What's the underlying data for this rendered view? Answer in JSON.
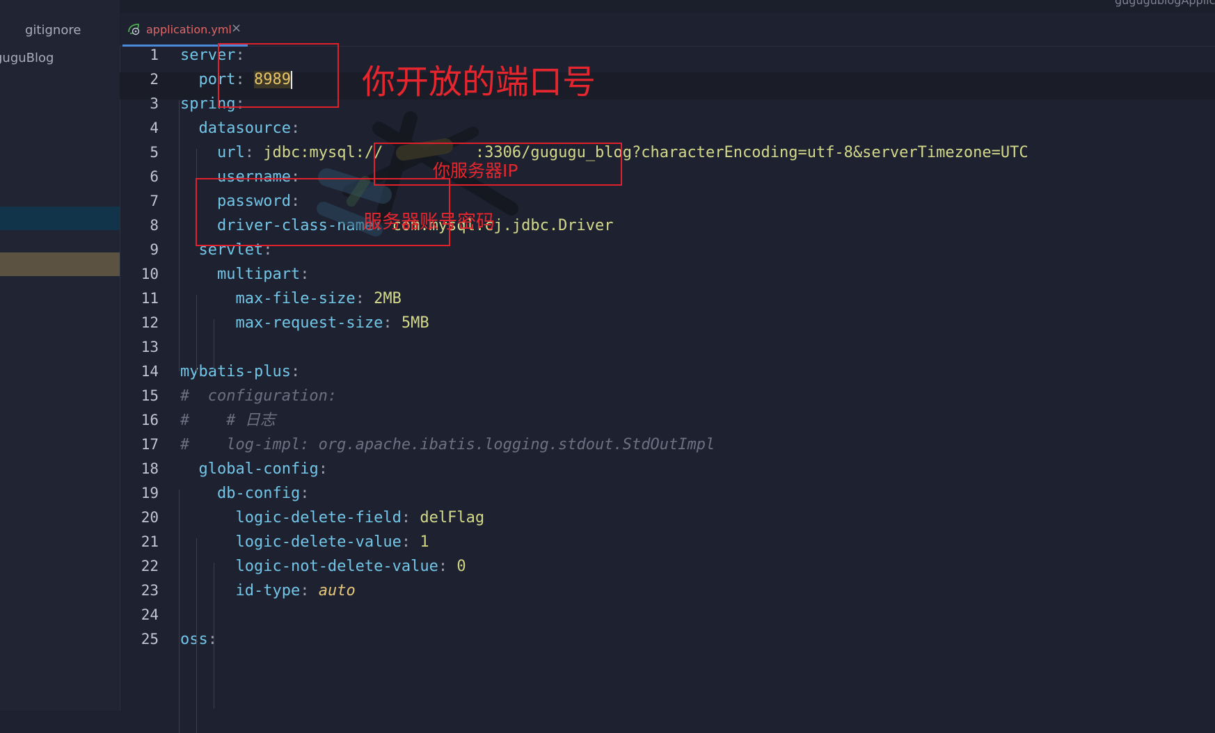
{
  "sidebar": {
    "items": [
      "gitignore",
      "guguBlog"
    ]
  },
  "top": {
    "run_config": "gugugublogApplication"
  },
  "tab": {
    "label": "application.yml",
    "close": "×"
  },
  "editor": {
    "lines": [
      {
        "n": "1",
        "parts": [
          [
            "k",
            "server"
          ],
          [
            "p",
            ":"
          ]
        ]
      },
      {
        "n": "2",
        "parts": [
          [
            "s",
            "  "
          ],
          [
            "k",
            "port"
          ],
          [
            "p",
            ": "
          ],
          [
            "hl",
            "8989"
          ]
        ]
      },
      {
        "n": "3",
        "parts": [
          [
            "k",
            "spring"
          ],
          [
            "p",
            ":"
          ]
        ]
      },
      {
        "n": "4",
        "parts": [
          [
            "s",
            "  "
          ],
          [
            "k",
            "datasource"
          ],
          [
            "p",
            ":"
          ]
        ]
      },
      {
        "n": "5",
        "parts": [
          [
            "s",
            "    "
          ],
          [
            "k",
            "url"
          ],
          [
            "p",
            ": "
          ],
          [
            "v",
            "jdbc:mysql://"
          ],
          [
            "s",
            "          "
          ],
          [
            "v",
            ":3306/gugugu_blog?characterEncoding=utf-8&serverTimezone=UTC"
          ]
        ]
      },
      {
        "n": "6",
        "parts": [
          [
            "s",
            "    "
          ],
          [
            "k",
            "username"
          ],
          [
            "p",
            ":"
          ]
        ]
      },
      {
        "n": "7",
        "parts": [
          [
            "s",
            "    "
          ],
          [
            "k",
            "password"
          ],
          [
            "p",
            ":"
          ]
        ]
      },
      {
        "n": "8",
        "parts": [
          [
            "s",
            "    "
          ],
          [
            "k",
            "driver-class-name"
          ],
          [
            "p",
            ": "
          ],
          [
            "v",
            "com.mysql.cj.jdbc.Driver"
          ]
        ]
      },
      {
        "n": "9",
        "parts": [
          [
            "s",
            "  "
          ],
          [
            "k",
            "servlet"
          ],
          [
            "p",
            ":"
          ]
        ]
      },
      {
        "n": "10",
        "parts": [
          [
            "s",
            "    "
          ],
          [
            "k",
            "multipart"
          ],
          [
            "p",
            ":"
          ]
        ]
      },
      {
        "n": "11",
        "parts": [
          [
            "s",
            "      "
          ],
          [
            "k",
            "max-file-size"
          ],
          [
            "p",
            ": "
          ],
          [
            "v",
            "2MB"
          ]
        ]
      },
      {
        "n": "12",
        "parts": [
          [
            "s",
            "      "
          ],
          [
            "k",
            "max-request-size"
          ],
          [
            "p",
            ": "
          ],
          [
            "v",
            "5MB"
          ]
        ]
      },
      {
        "n": "13",
        "parts": []
      },
      {
        "n": "14",
        "parts": [
          [
            "k",
            "mybatis-plus"
          ],
          [
            "p",
            ":"
          ]
        ]
      },
      {
        "n": "15",
        "parts": [
          [
            "c",
            "#  configuration:"
          ]
        ]
      },
      {
        "n": "16",
        "parts": [
          [
            "c",
            "#    # 日志"
          ]
        ]
      },
      {
        "n": "17",
        "parts": [
          [
            "c",
            "#    log-impl: org.apache.ibatis.logging.stdout.StdOutImpl"
          ]
        ]
      },
      {
        "n": "18",
        "parts": [
          [
            "s",
            "  "
          ],
          [
            "k",
            "global-config"
          ],
          [
            "p",
            ":"
          ]
        ]
      },
      {
        "n": "19",
        "parts": [
          [
            "s",
            "    "
          ],
          [
            "k",
            "db-config"
          ],
          [
            "p",
            ":"
          ]
        ]
      },
      {
        "n": "20",
        "parts": [
          [
            "s",
            "      "
          ],
          [
            "k",
            "logic-delete-field"
          ],
          [
            "p",
            ": "
          ],
          [
            "v",
            "delFlag"
          ]
        ]
      },
      {
        "n": "21",
        "parts": [
          [
            "s",
            "      "
          ],
          [
            "k",
            "logic-delete-value"
          ],
          [
            "p",
            ": "
          ],
          [
            "n",
            "1"
          ]
        ]
      },
      {
        "n": "22",
        "parts": [
          [
            "s",
            "      "
          ],
          [
            "k",
            "logic-not-delete-value"
          ],
          [
            "p",
            ": "
          ],
          [
            "n",
            "0"
          ]
        ]
      },
      {
        "n": "23",
        "parts": [
          [
            "s",
            "      "
          ],
          [
            "k",
            "id-type"
          ],
          [
            "p",
            ": "
          ],
          [
            "it",
            "auto"
          ]
        ]
      },
      {
        "n": "24",
        "parts": []
      },
      {
        "n": "25",
        "parts": [
          [
            "k",
            "oss"
          ],
          [
            "p",
            ":"
          ]
        ]
      }
    ]
  },
  "annotations": {
    "port_note": "你开放的端口号",
    "ip_note": "你服务器IP",
    "account_note": "服务器账号密码"
  },
  "colors": {
    "annotation_red": "#e5262e",
    "key": "#73c6e8",
    "value": "#d4d98a",
    "comment": "#6b7181",
    "tab_label": "#e06767"
  }
}
